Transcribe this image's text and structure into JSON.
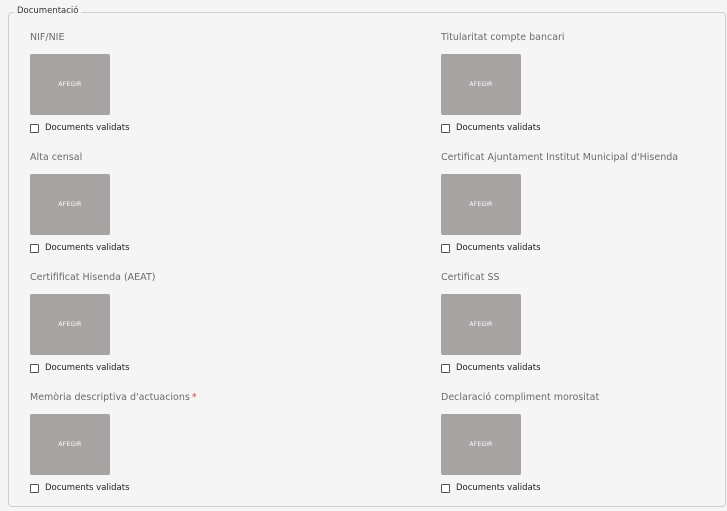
{
  "section": {
    "legend": "Documentació"
  },
  "documents": [
    {
      "label": "NIF/NIE",
      "required": false,
      "button": "AFEGIR",
      "checkbox_label": "Documents validats"
    },
    {
      "label": "Titularitat compte bancari",
      "required": false,
      "button": "AFEGIR",
      "checkbox_label": "Documents validats"
    },
    {
      "label": "Alta censal",
      "required": false,
      "button": "AFEGIR",
      "checkbox_label": "Documents validats"
    },
    {
      "label": "Certificat Ajuntament Institut Municipal d'Hisenda",
      "required": false,
      "button": "AFEGIR",
      "checkbox_label": "Documents validats"
    },
    {
      "label": "Certifificat Hisenda (AEAT)",
      "required": false,
      "button": "AFEGIR",
      "checkbox_label": "Documents validats"
    },
    {
      "label": "Certificat SS",
      "required": false,
      "button": "AFEGIR",
      "checkbox_label": "Documents validats"
    },
    {
      "label": "Memòria descriptiva d'actuacions",
      "required": true,
      "required_mark": "*",
      "button": "AFEGIR",
      "checkbox_label": "Documents validats"
    },
    {
      "label": "Declaració compliment morositat",
      "required": false,
      "button": "AFEGIR",
      "checkbox_label": "Documents validats"
    }
  ],
  "colors": {
    "background": "#f5f5f5",
    "button": "#a8a3a3",
    "required": "#e53935"
  }
}
